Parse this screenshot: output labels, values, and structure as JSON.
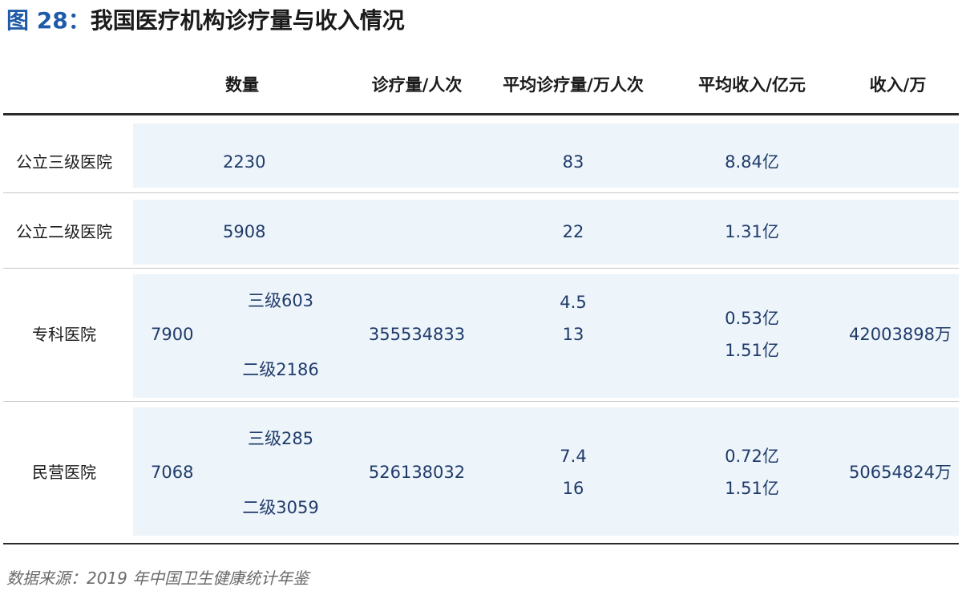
{
  "figure": {
    "label": "图 28：",
    "title": "我国医疗机构诊疗量与收入情况"
  },
  "columns": {
    "count": "数量",
    "visits": "诊疗量/人次",
    "avg_visits": "平均诊疗量/万人次",
    "avg_income": "平均收入/亿元",
    "income": "收入/万"
  },
  "rows": [
    {
      "name": "公立三级医院",
      "count": "2230",
      "avg_visits": "83",
      "avg_income": "8.84亿"
    },
    {
      "name": "公立二级医院",
      "count": "5908",
      "avg_visits": "22",
      "avg_income": "1.31亿"
    },
    {
      "name": "专科医院",
      "count": "7900",
      "sub_tier3": "三级603",
      "sub_tier2": "二级2186",
      "visits": "355534833",
      "avg_visits_1": "4.5",
      "avg_visits_2": "13",
      "avg_income_1": "0.53亿",
      "avg_income_2": "1.51亿",
      "income": "42003898万"
    },
    {
      "name": "民营医院",
      "count": "7068",
      "sub_tier3": "三级285",
      "sub_tier2": "二级3059",
      "visits": "526138032",
      "avg_visits_1": "7.4",
      "avg_visits_2": "16",
      "avg_income_1": "0.72亿",
      "avg_income_2": "1.51亿",
      "income": "50654824万"
    }
  ],
  "source": "数据来源：2019 年中国卫生健康统计年鉴"
}
